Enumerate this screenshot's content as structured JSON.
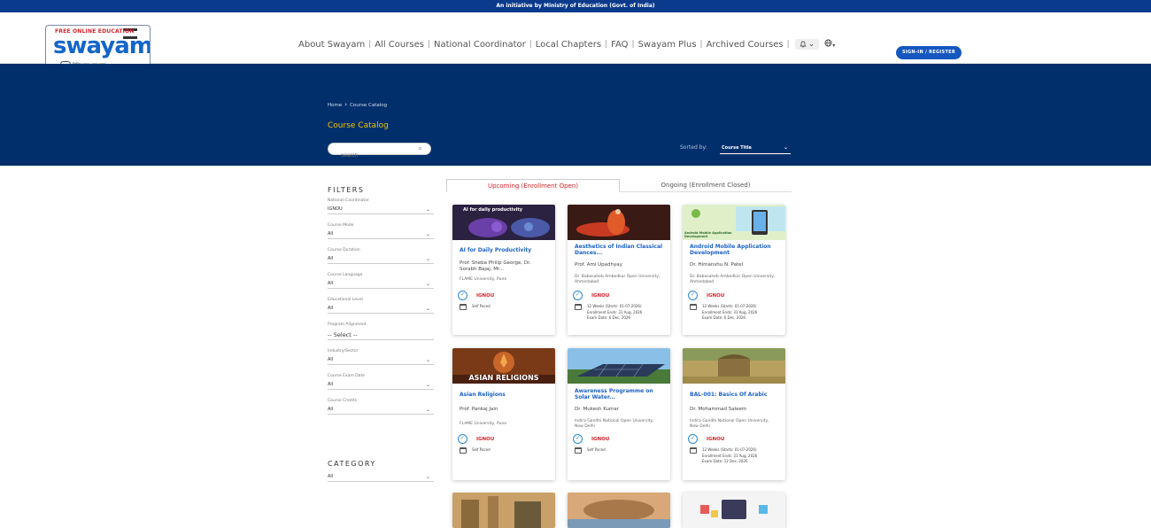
{
  "top_banner": "An initiative by Ministry of Education (Govt. of India)",
  "logo": {
    "tagline": "FREE ONLINE EDUCATION",
    "wordmark": "swayam",
    "subtitle": "शिक्षित भारत, उन्नत भारत"
  },
  "nav": {
    "items": [
      "About Swayam",
      "All Courses",
      "National Coordinator",
      "Local Chapters",
      "FAQ",
      "Swayam Plus",
      "Archived Courses"
    ],
    "bell_icon": "bell-icon",
    "globe_icon": "globe-icon",
    "signin_label": "SIGN-IN / REGISTER"
  },
  "hero": {
    "breadcrumb": [
      "Home",
      "Course Catalog"
    ],
    "title": "Course Catalog",
    "search_placeholder": "Search",
    "sort_label": "Sorted by:",
    "sort_value": "Course Title"
  },
  "filters": {
    "heading": "FILTERS",
    "groups": [
      {
        "label": "National Coordinator",
        "value": "IGNOU"
      },
      {
        "label": "Course Mode",
        "value": "All"
      },
      {
        "label": "Course Duration",
        "value": "All"
      },
      {
        "label": "Course Language",
        "value": "All"
      },
      {
        "label": "Educational Level",
        "value": "All"
      },
      {
        "label": "Program Alignment",
        "value": "-- Select --"
      },
      {
        "label": "Industry/Sector",
        "value": "All"
      },
      {
        "label": "Course Exam Date",
        "value": "All"
      },
      {
        "label": "Course Credits",
        "value": "All"
      }
    ],
    "category_heading": "CATEGORY",
    "category_value": "All"
  },
  "tabs": {
    "active": "Upcoming (Enrollment Open)",
    "inactive": "Ongoing (Enrollment Closed)"
  },
  "courses": [
    {
      "title": "AI for Daily Productivity",
      "instructor": "Prof. Sheba Philip George, Dr. Sorabh Bajaj, Mr...",
      "university": "FLAME University, Pune",
      "coordinator": "IGNOU",
      "schedule": [
        "Self Paced"
      ],
      "thumb_text": "AI for daily productivity"
    },
    {
      "title": "Aesthetics of Indian Classical Dances...",
      "instructor": "Prof. Ami Upadhyay",
      "university": "Dr. Babasaheb Ambedkar Open University, Ahmedabad",
      "coordinator": "IGNOU",
      "schedule": [
        "12 Weeks (Starts: 01-07-2026)",
        "Enrollment Ends: 31 Aug, 2026",
        "Exam Date: 6 Dec, 2026"
      ],
      "thumb_text": ""
    },
    {
      "title": "Android Mobile Application Development",
      "instructor": "Dr. Himanshu N. Patel",
      "university": "Dr. Babasaheb Ambedkar Open University, Ahmedabad",
      "coordinator": "IGNOU",
      "schedule": [
        "12 Weeks (Starts: 01-07-2026)",
        "Enrollment Ends: 31 Aug, 2026",
        "Exam Date: 6 Dec, 2026"
      ],
      "thumb_text": "Android Mobile Application Development"
    },
    {
      "title": "Asian Religions",
      "instructor": "Prof. Pankaj Jain",
      "university": "FLAME University, Pune",
      "coordinator": "IGNOU",
      "schedule": [
        "Self Paced"
      ],
      "thumb_text": "ASIAN RELIGIONS"
    },
    {
      "title": "Awareness Programme on Solar Water...",
      "instructor": "Dr. Mukesh Kumar",
      "university": "Indira Gandhi National Open University, New Delhi",
      "coordinator": "IGNOU",
      "schedule": [
        "Self Paced"
      ],
      "thumb_text": ""
    },
    {
      "title": "BAL-001: Basics Of Arabic",
      "instructor": "Dr. Mohammad Saleem",
      "university": "Indira Gandhi National Open University, New Delhi",
      "coordinator": "IGNOU",
      "schedule": [
        "12 Weeks (Starts: 01-07-2026)",
        "Enrollment Ends: 31 Aug, 2026",
        "Exam Date: 12 Dec, 2026"
      ],
      "thumb_text": ""
    }
  ],
  "colors": {
    "top_strip": "#0a3a8c",
    "hero_bg": "#002f6c",
    "accent_yellow": "#f3c400",
    "link_blue": "#1c62c8",
    "signin_blue": "#1557c0",
    "coordinator_red": "#d8232a"
  }
}
